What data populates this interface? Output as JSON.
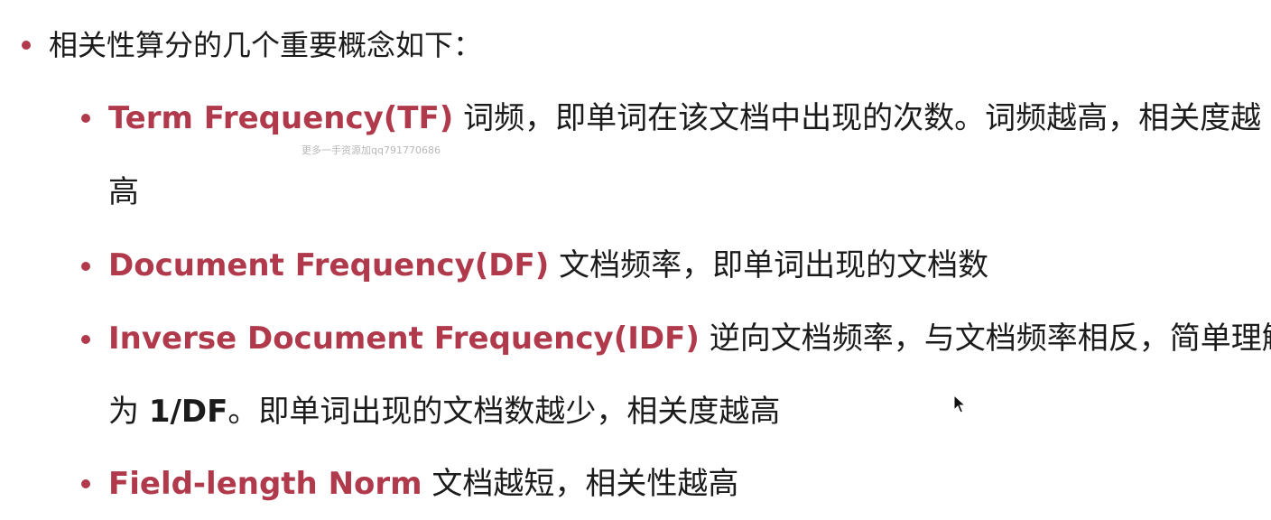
{
  "heading": "相关性算分的几个重要概念如下：",
  "watermark": "更多一手资源加qq791770686",
  "items": [
    {
      "term": "Term Frequency(TF)",
      "text_line1": " 词频，即单词在该文档中出现的次数。词频越高，相关度越",
      "text_line2": "高"
    },
    {
      "term": "Document Frequency(DF)",
      "text": " 文档频率，即单词出现的文档数"
    },
    {
      "term": "Inverse Document Frequency(IDF)",
      "text_line1": " 逆向文档频率，与文档频率相反，简单理解",
      "line2_prefix": "为 ",
      "line2_bold": "1/DF",
      "line2_rest": "。即单词出现的文档数越少，相关度越高"
    },
    {
      "term": "Field-length Norm",
      "text": " 文档越短，相关性越高"
    }
  ],
  "colors": {
    "accent": "#b03a4c",
    "text": "#1b1b1b",
    "watermark": "#b8b8b8"
  },
  "icons": {
    "bullet": "bullet-dot-icon",
    "cursor": "mouse-cursor-icon"
  }
}
